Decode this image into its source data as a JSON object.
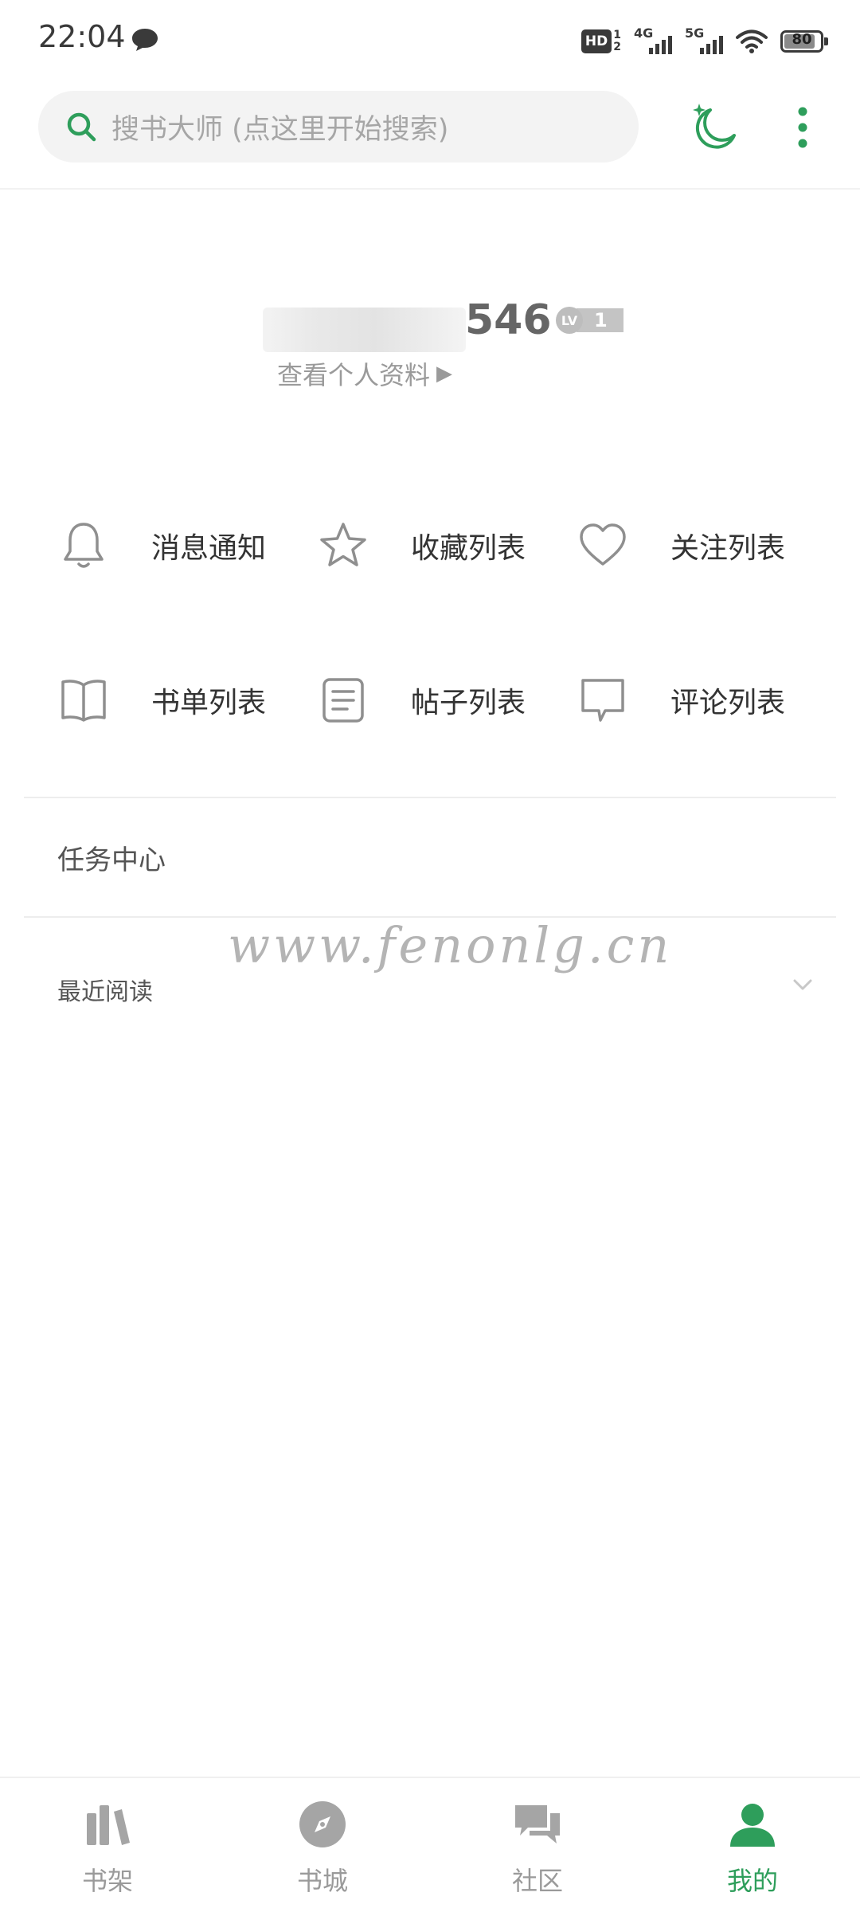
{
  "status_bar": {
    "time": "22:04",
    "hd_label": "HD",
    "hd_sub_top": "1",
    "hd_sub_bottom": "2",
    "signal_1": "4G",
    "signal_2": "5G",
    "battery": "80"
  },
  "header": {
    "search_placeholder": "搜书大师 (点这里开始搜索)",
    "accent_color": "#2e9e5b"
  },
  "profile": {
    "username_visible": "546",
    "level_prefix": "LV",
    "level": "1",
    "view_profile": "查看个人资料",
    "view_profile_arrow": "▶"
  },
  "grid": [
    {
      "label": "消息通知",
      "icon": "bell-icon"
    },
    {
      "label": "收藏列表",
      "icon": "star-icon"
    },
    {
      "label": "关注列表",
      "icon": "heart-icon"
    },
    {
      "label": "书单列表",
      "icon": "book-icon"
    },
    {
      "label": "帖子列表",
      "icon": "document-icon"
    },
    {
      "label": "评论列表",
      "icon": "comment-icon"
    }
  ],
  "sections": {
    "task_center": "任务中心",
    "recent_reading": "最近阅读"
  },
  "watermark": "www.fenonlg.cn",
  "bottom_nav": [
    {
      "label": "书架",
      "icon": "bookshelf-icon",
      "active": false
    },
    {
      "label": "书城",
      "icon": "compass-icon",
      "active": false
    },
    {
      "label": "社区",
      "icon": "chat-bubbles-icon",
      "active": false
    },
    {
      "label": "我的",
      "icon": "person-icon",
      "active": true
    }
  ]
}
